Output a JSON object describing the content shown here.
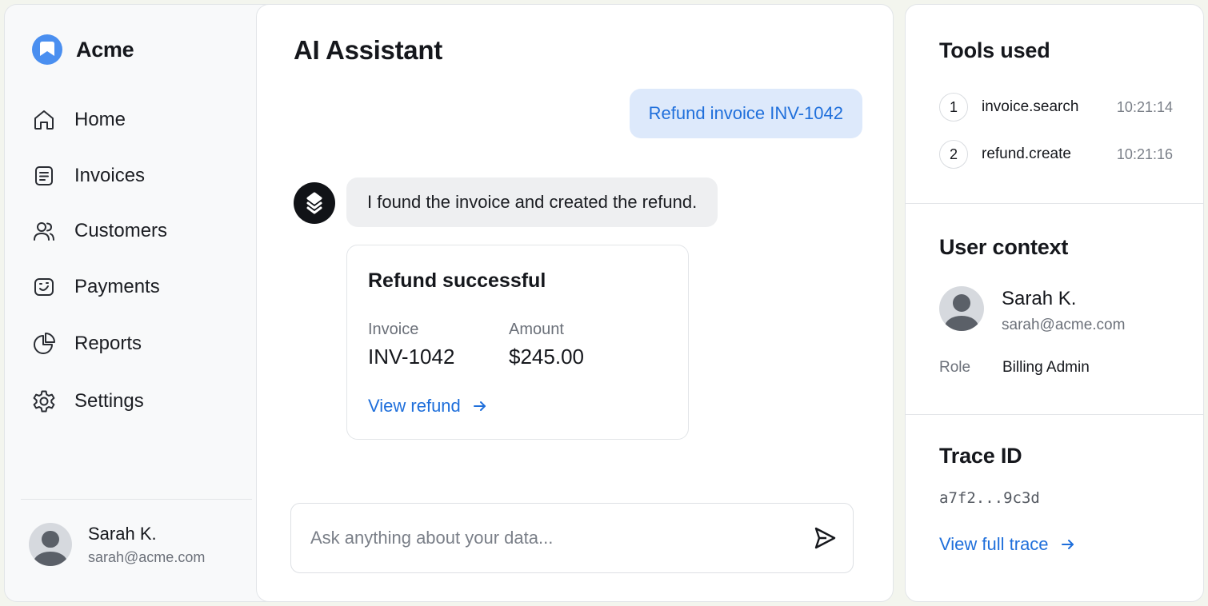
{
  "app": {
    "name": "Acme"
  },
  "sidebar": {
    "items": [
      {
        "label": "Home",
        "icon": "home-icon"
      },
      {
        "label": "Invoices",
        "icon": "invoice-icon"
      },
      {
        "label": "Customers",
        "icon": "users-icon"
      },
      {
        "label": "Payments",
        "icon": "payment-icon"
      },
      {
        "label": "Reports",
        "icon": "pie-chart-icon"
      },
      {
        "label": "Settings",
        "icon": "gear-icon"
      }
    ],
    "user": {
      "name": "Sarah K.",
      "email": "sarah@acme.com"
    }
  },
  "main": {
    "title": "AI Assistant",
    "user_message": "Refund invoice INV-1042",
    "assistant_message": "I found the invoice and created the refund.",
    "result_card": {
      "title": "Refund successful",
      "invoice_label": "Invoice",
      "invoice_value": "INV-1042",
      "amount_label": "Amount",
      "amount_value": "$245.00",
      "link_label": "View refund"
    },
    "composer": {
      "placeholder": "Ask anything about your data..."
    }
  },
  "right_panel": {
    "tools_title": "Tools used",
    "tools": [
      {
        "num": "1",
        "name": "invoice.search",
        "time": "10:21:14"
      },
      {
        "num": "2",
        "name": "refund.create",
        "time": "10:21:16"
      }
    ],
    "context_title": "User context",
    "context_user": {
      "name": "Sarah K.",
      "email": "sarah@acme.com"
    },
    "role_label": "Role",
    "role_value": "Billing Admin",
    "trace_title": "Trace ID",
    "trace_id": "a7f2...9c3d",
    "trace_link": "View full trace"
  },
  "colors": {
    "accent": "#1f6fdb",
    "user_bubble": "#dde9fb",
    "brand": "#4a8ff0"
  }
}
